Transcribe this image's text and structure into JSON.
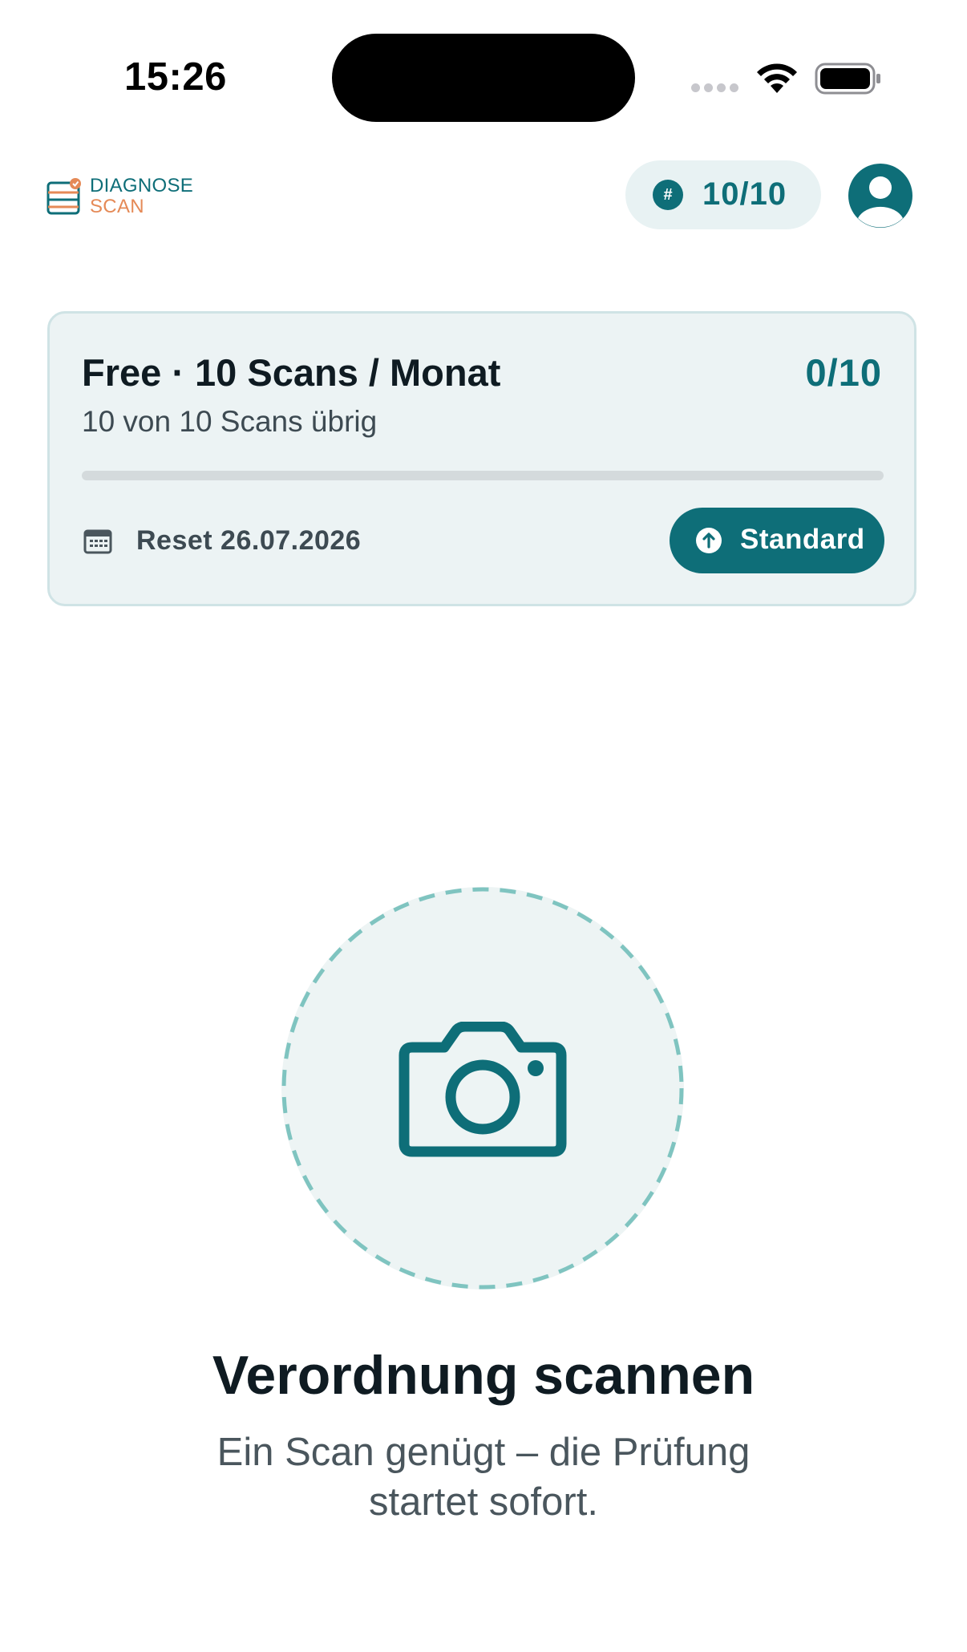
{
  "status_bar": {
    "time": "15:26",
    "icons": [
      "cellular-signal-icon",
      "wifi-icon",
      "battery-icon"
    ]
  },
  "header": {
    "logo": {
      "line1": "DIAGNOSE",
      "line2": "SCAN"
    },
    "credits": {
      "icon": "hash-icon",
      "value": "10/10"
    },
    "profile_icon": "user-icon"
  },
  "plan_card": {
    "title": "Free · 10 Scans / Monat",
    "count": "0/10",
    "subtitle": "10 von 10 Scans übrig",
    "usage_fraction": 0,
    "reset_icon": "calendar-icon",
    "reset_text": "Reset 26.07.2026",
    "upgrade_button": {
      "icon": "arrow-up-circle-icon",
      "label": "Standard"
    }
  },
  "scan": {
    "icon": "camera-icon",
    "title": "Verordnung scannen",
    "subtitle_line1": "Ein Scan genügt – die Prüfung",
    "subtitle_line2": "startet sofort."
  },
  "colors": {
    "brand": "#0e6e78",
    "accent_orange": "#e58a57",
    "card_bg": "#ecf3f4",
    "dashed_ring": "#7fc4c0"
  }
}
